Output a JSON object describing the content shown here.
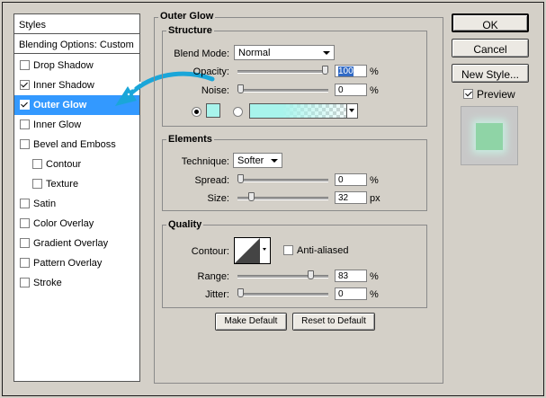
{
  "styles_panel": {
    "header": "Styles",
    "blending_options": "Blending Options: Custom",
    "items": [
      {
        "label": "Drop Shadow",
        "checked": false,
        "selected": false,
        "indent": false
      },
      {
        "label": "Inner Shadow",
        "checked": true,
        "selected": false,
        "indent": false
      },
      {
        "label": "Outer Glow",
        "checked": true,
        "selected": true,
        "indent": false
      },
      {
        "label": "Inner Glow",
        "checked": false,
        "selected": false,
        "indent": false
      },
      {
        "label": "Bevel and Emboss",
        "checked": false,
        "selected": false,
        "indent": false
      },
      {
        "label": "Contour",
        "checked": false,
        "selected": false,
        "indent": true
      },
      {
        "label": "Texture",
        "checked": false,
        "selected": false,
        "indent": true
      },
      {
        "label": "Satin",
        "checked": false,
        "selected": false,
        "indent": false
      },
      {
        "label": "Color Overlay",
        "checked": false,
        "selected": false,
        "indent": false
      },
      {
        "label": "Gradient Overlay",
        "checked": false,
        "selected": false,
        "indent": false
      },
      {
        "label": "Pattern Overlay",
        "checked": false,
        "selected": false,
        "indent": false
      },
      {
        "label": "Stroke",
        "checked": false,
        "selected": false,
        "indent": false
      }
    ]
  },
  "outer_glow": {
    "title": "Outer Glow",
    "structure": {
      "title": "Structure",
      "blend_mode_label": "Blend Mode:",
      "blend_mode_value": "Normal",
      "opacity_label": "Opacity:",
      "opacity_value": "100",
      "opacity_pct": 100,
      "noise_label": "Noise:",
      "noise_value": "0",
      "noise_pct": 0,
      "percent": "%",
      "glow_color": "#a8f4ec"
    },
    "elements": {
      "title": "Elements",
      "technique_label": "Technique:",
      "technique_value": "Softer",
      "spread_label": "Spread:",
      "spread_value": "0",
      "spread_pct": 0,
      "size_label": "Size:",
      "size_value": "32",
      "size_fraction": 0.13,
      "percent": "%",
      "px": "px"
    },
    "quality": {
      "title": "Quality",
      "contour_label": "Contour:",
      "anti_aliased_label": "Anti-aliased",
      "anti_aliased": false,
      "range_label": "Range:",
      "range_value": "83",
      "range_pct": 83,
      "jitter_label": "Jitter:",
      "jitter_value": "0",
      "jitter_pct": 0,
      "percent": "%"
    },
    "make_default": "Make Default",
    "reset_to_default": "Reset to Default"
  },
  "actions": {
    "ok": "OK",
    "cancel": "Cancel",
    "new_style": "New Style...",
    "preview_label": "Preview",
    "preview_checked": true
  },
  "colors": {
    "selection": "#3399ff",
    "arrow": "#1aa6d9",
    "preview_swatch": "#8fd4a6"
  }
}
